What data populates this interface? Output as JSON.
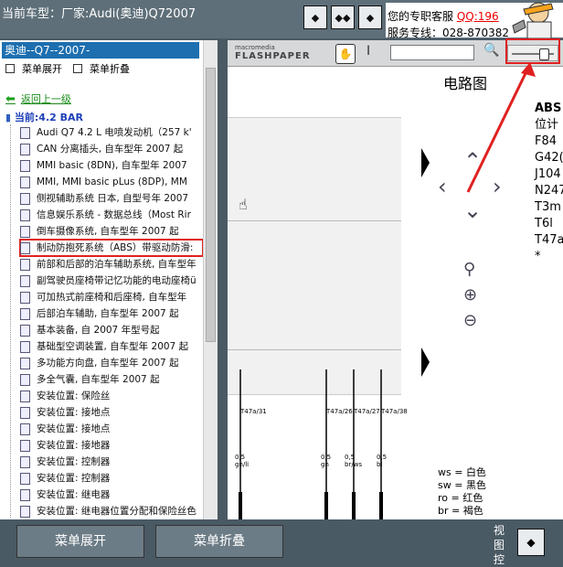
{
  "header": {
    "car_label": "当前车型：厂家:Audi(奥迪)Q72007",
    "nav_buttons": [
      "◆",
      "◆◆",
      "◆"
    ],
    "service_label": "您的专职客服",
    "service_qq": "QQ:196",
    "hotline": "服务专线：028-870382"
  },
  "sidebar": {
    "title": "奥迪--Q7--2007-",
    "expand_all": "菜单展开",
    "collapse_all": "菜单折叠",
    "back_link": "返回上一级",
    "current": "当前:4.2 BAR",
    "items": [
      {
        "label": "Audi Q7 4.2 L 电喷发动机（257 k'"
      },
      {
        "label": "CAN 分离插头, 自车型年 2007 起"
      },
      {
        "label": "MMI basic (8DN), 自车型年 2007"
      },
      {
        "label": "MMI, MMI basic pLus (8DP), MM"
      },
      {
        "label": "侧视辅助系统 日本, 自型号年 2007"
      },
      {
        "label": "信息娱乐系统 - 数据总线（Most Rir"
      },
      {
        "label": "倒车摄像系统, 自车型年 2007 起"
      },
      {
        "label": "制动防抱死系统（ABS）带驱动防滑:",
        "highlighted": true
      },
      {
        "label": "前部和后部的泊车辅助系统, 自车型年"
      },
      {
        "label": "副驾驶员座椅带记忆功能的电动座椅ü"
      },
      {
        "label": "可加热式前座椅和后座椅, 自车型年"
      },
      {
        "label": "后部泊车辅助, 自车型年 2007 起"
      },
      {
        "label": "基本装备, 自 2007 年型号起"
      },
      {
        "label": "基础型空调装置, 自车型年 2007 起"
      },
      {
        "label": "多功能方向盘, 自车型年 2007 起"
      },
      {
        "label": "多全气囊, 自车型年 2007 起"
      },
      {
        "label": "安装位置: 保险丝"
      },
      {
        "label": "安装位置: 接地点"
      },
      {
        "label": "安装位置: 接地点"
      },
      {
        "label": "安装位置: 接地器"
      },
      {
        "label": "安装位置: 控制器"
      },
      {
        "label": "安装位置: 控制器"
      },
      {
        "label": "安装位置: 继电器"
      },
      {
        "label": "安装位置: 继电器位置分配和保险丝色"
      }
    ]
  },
  "viewer": {
    "brand_small": "macromedia",
    "brand_big": "FLASHPAPER",
    "hand_icon": "✋",
    "ibeam": "I",
    "search_icon": "🔍",
    "doc_title": "电路图",
    "right_lines": [
      "ABS",
      "位计",
      "F84",
      "G42(",
      "J104",
      "N247",
      "T3m",
      "T6l",
      "T47a",
      "*"
    ],
    "wire_labels": [
      "T47a/31",
      "T47a/26",
      "T47a/27",
      "T47a/38"
    ],
    "wire_specs": [
      "0,5\ngn/li",
      "0,5\ngn",
      "0,5\nbr/ws",
      "0,5\nbl"
    ],
    "legend": "ws = 白色\nsw = 黑色\nro = 红色\nbr = 褐色"
  },
  "footer": {
    "expand_btn": "菜单展开",
    "collapse_btn": "菜单折叠",
    "view_label": "视图控",
    "nav_btn": "◆"
  },
  "colors": {
    "accent_red": "#e02020",
    "header_bg": "#5e6f79",
    "selection_blue": "#1d6fb0"
  }
}
